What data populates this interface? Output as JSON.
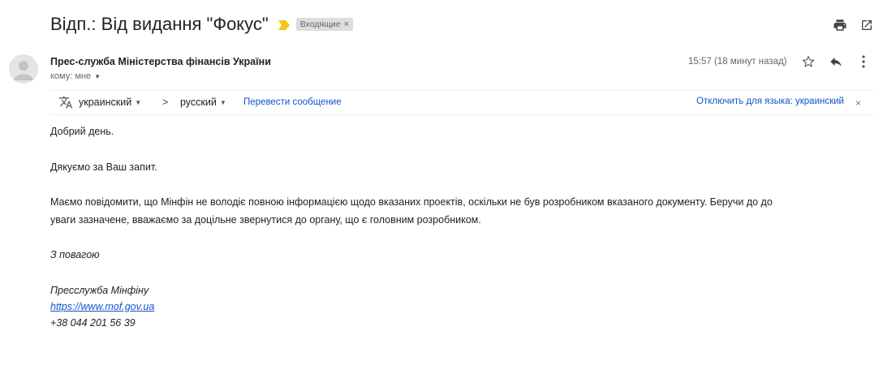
{
  "email": {
    "subject": "Відп.: Від видання \"Фокус\"",
    "label": "Входящие",
    "label_close": "×",
    "sender": "Прес-служба Міністерства фінансів України",
    "recipient": "кому: мне",
    "time": "15:57 (18 минут назад)"
  },
  "translate": {
    "source_lang": "украинский",
    "arrow": ">",
    "target_lang": "русский",
    "translate_link": "Перевести сообщение",
    "disable_link": "Отключить для языка: украинский",
    "close": "×"
  },
  "body": {
    "greeting": "Добрий день.",
    "thanks": "Дякуємо за Ваш запит.",
    "main_line1": "Маємо повідомити, що Мінфін не володіє повною інформацією щодо вказаних проектів, оскільки не був розробником вказаного документу. Беручи до до",
    "main_line2": "уваги зазначене, вважаємо за доцільне звернутися до органу, що є головним розробником.",
    "regards": "З повагою",
    "sig_name": "Пресслужба Мінфіну",
    "sig_link": "https://www.mof.gov.ua",
    "sig_phone": "+38 044 201 56 39"
  },
  "icons": {
    "important": "important-marker-icon",
    "print": "print-icon",
    "popout": "open-in-new-window-icon",
    "avatar": "default-avatar-icon",
    "star": "star-icon",
    "reply": "reply-icon",
    "more": "more-vertical-icon",
    "translate": "translate-icon"
  },
  "colors": {
    "important": "#f5c518",
    "link": "#1155cc",
    "label_bg": "#dddddd"
  }
}
